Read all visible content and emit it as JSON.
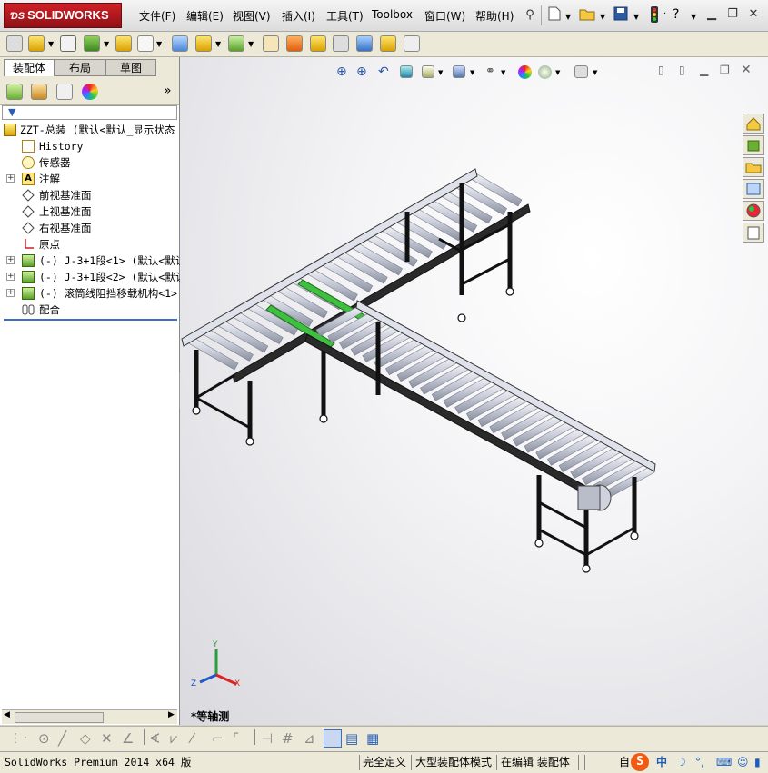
{
  "app": {
    "logo_text": "SOLIDWORKS",
    "menu": [
      "文件(F)",
      "编辑(E)",
      "视图(V)",
      "插入(I)",
      "工具(T)",
      "Toolbox",
      "窗口(W)",
      "帮助(H)"
    ],
    "help_label": "?",
    "colors": {
      "brand_red": "#c1171d",
      "panel_bg": "#ffffff",
      "toolbar_bg": "#ece9d8"
    }
  },
  "left_panel": {
    "tabs": [
      "装配体",
      "布局",
      "草图"
    ],
    "expand_label": "»",
    "tree": [
      {
        "label": "ZZT-总装  (默认<默认_显示状态",
        "icon": "assembly-icon"
      },
      {
        "label": "History",
        "icon": "history-icon"
      },
      {
        "label": "传感器",
        "icon": "sensor-icon"
      },
      {
        "label": "注解",
        "icon": "annotation-icon"
      },
      {
        "label": "前视基准面",
        "icon": "plane-icon"
      },
      {
        "label": "上视基准面",
        "icon": "plane-icon"
      },
      {
        "label": "右视基准面",
        "icon": "plane-icon"
      },
      {
        "label": "原点",
        "icon": "origin-icon"
      },
      {
        "label": "(-) J-3+1段<1> (默认<默认_",
        "icon": "subassembly-icon"
      },
      {
        "label": "(-) J-3+1段<2> (默认<默认_",
        "icon": "subassembly-icon"
      },
      {
        "label": "(-) 滚筒线阻挡移载机构<1>",
        "icon": "subassembly-icon"
      },
      {
        "label": "配合",
        "icon": "mates-icon"
      }
    ]
  },
  "viewport": {
    "view_label": "*等轴测",
    "triad": {
      "x": "X",
      "y": "Y",
      "z": "Z"
    }
  },
  "status": {
    "product": "SolidWorks Premium 2014 x64 版",
    "cells": [
      "完全定义",
      "大型装配体模式",
      "在编辑 装配体"
    ],
    "tray_letters": [
      "自",
      "中"
    ]
  }
}
